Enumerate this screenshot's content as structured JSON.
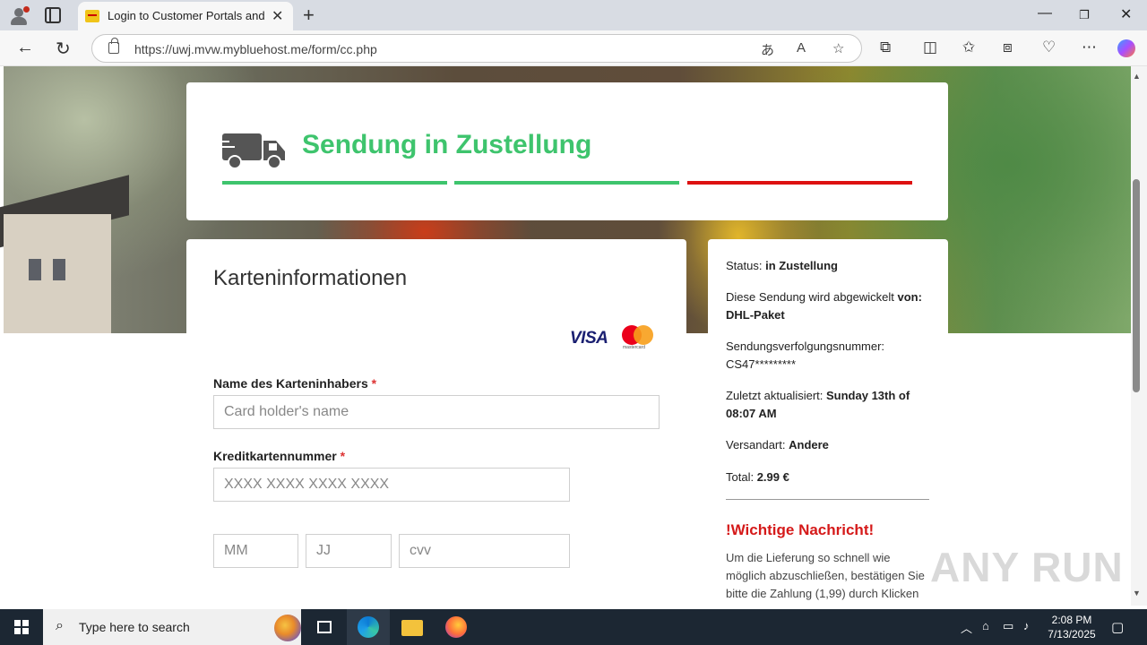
{
  "browser": {
    "tab_title": "Login to Customer Portals and To",
    "url": "https://uwj.mvw.mybluehost.me/form/cc.php"
  },
  "status_header": {
    "title": "Sendung in Zustellung",
    "progress_colors": [
      "#3ec46d",
      "#3ec46d",
      "#dd1111"
    ]
  },
  "card_form": {
    "title": "Karteninformationen",
    "visa_label": "VISA",
    "mastercard_label": "mastercard",
    "name_label": "Name des Karteninhabers",
    "name_placeholder": "Card holder's name",
    "number_label": "Kreditkartennummer",
    "number_placeholder": "XXXX XXXX XXXX XXXX",
    "required_mark": "*",
    "month_placeholder": "MM",
    "year_placeholder": "JJ",
    "cvv_placeholder": "cvv"
  },
  "shipment_info": {
    "status_label": "Status:",
    "status_value": "in Zustellung",
    "handled_by_label": "Diese Sendung wird abgewickelt",
    "handled_by_von": "von:",
    "handled_by_value": "DHL-Paket",
    "tracking_label": "Sendungsverfolgungsnummer:",
    "tracking_value": "CS47*********",
    "updated_label": "Zuletzt aktualisiert:",
    "updated_value": "Sunday 13th of 08:07 AM",
    "shipping_label": "Versandart:",
    "shipping_value": "Andere",
    "total_label": "Total:",
    "total_value": "2.99 €",
    "alert_title": "!Wichtige Nachricht!",
    "alert_body": "Um die Lieferung so schnell wie möglich abzuschließen, bestätigen Sie bitte die Zahlung (1,99) durch Klicken"
  },
  "watermark": "ANY RUN",
  "taskbar": {
    "search_text": "Type here to search",
    "time": "2:08 PM",
    "date": "7/13/2025"
  }
}
